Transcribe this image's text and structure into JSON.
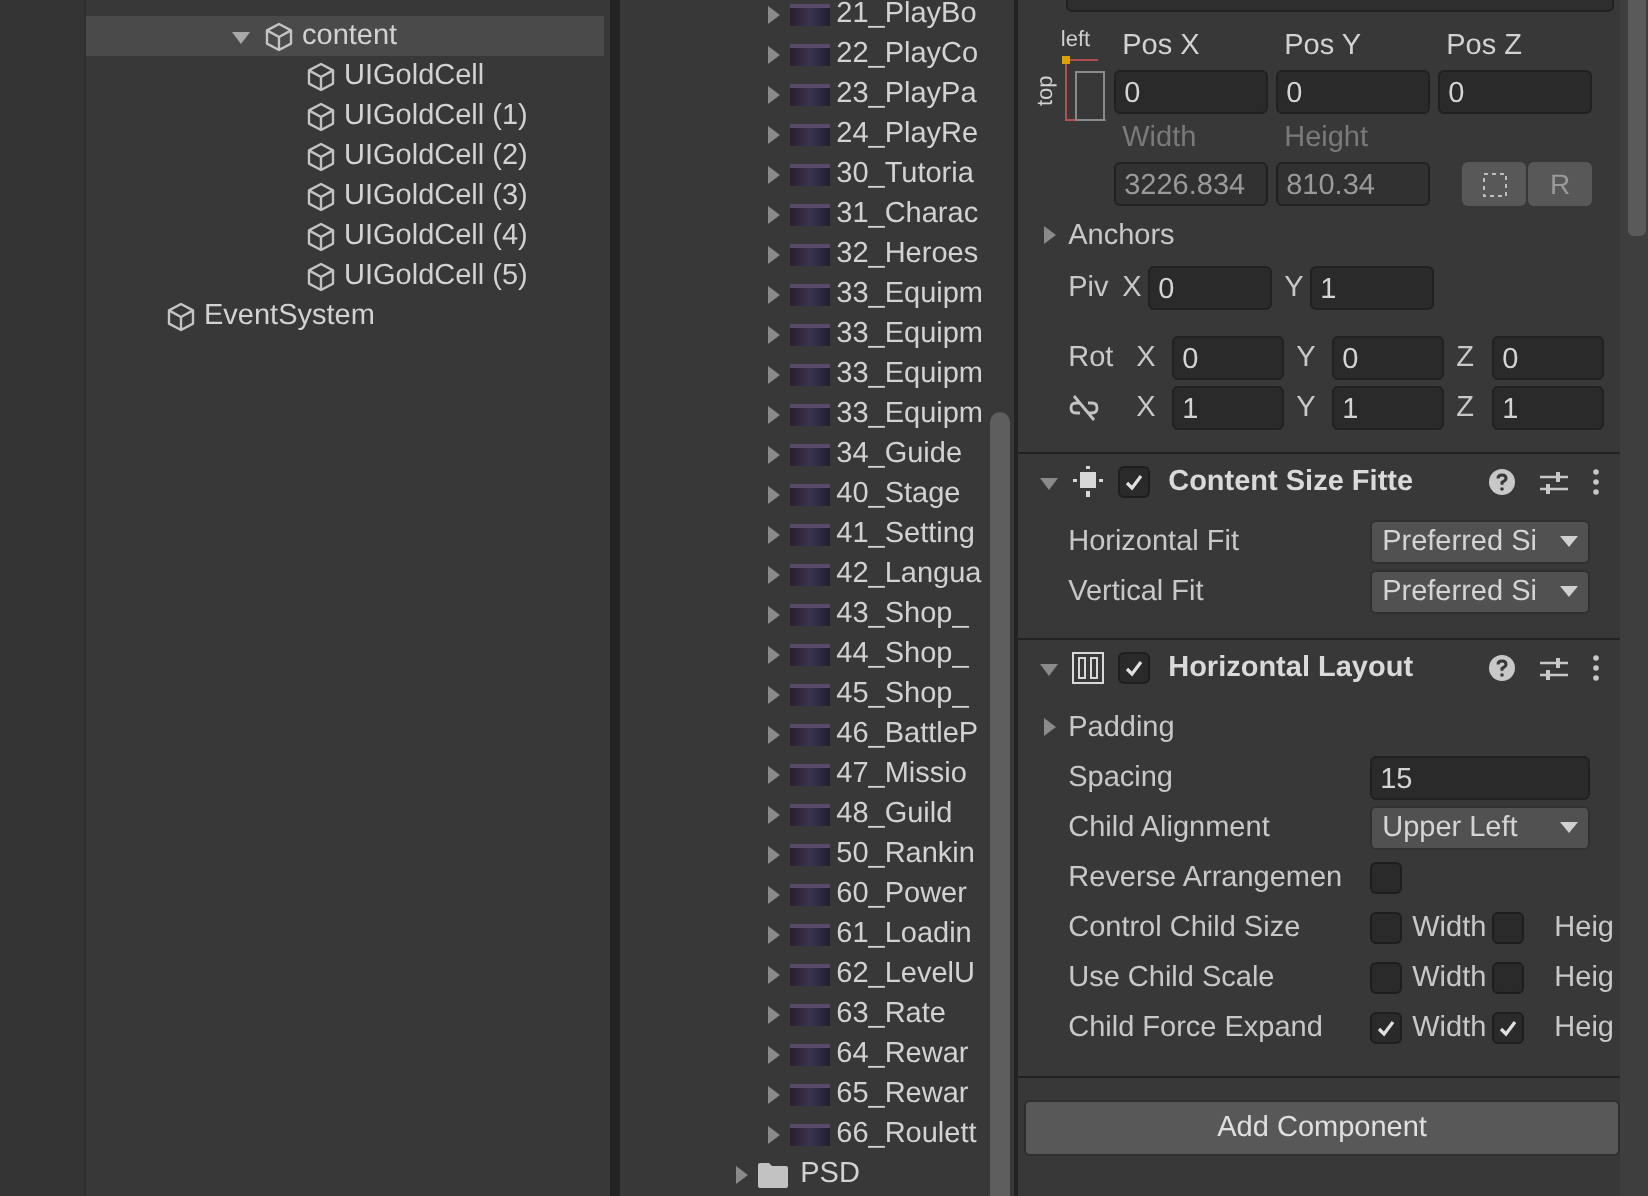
{
  "hierarchy": {
    "items": [
      {
        "name": "content",
        "selected": true,
        "expanded": true,
        "children": [
          {
            "name": "UIGoldCell",
            "selected": false
          },
          {
            "name": "UIGoldCell (1)",
            "selected": false
          },
          {
            "name": "UIGoldCell (2)",
            "selected": false
          },
          {
            "name": "UIGoldCell (3)",
            "selected": false
          },
          {
            "name": "UIGoldCell (4)",
            "selected": false
          },
          {
            "name": "UIGoldCell (5)",
            "selected": false
          }
        ]
      },
      {
        "name": "EventSystem",
        "selected": false
      }
    ]
  },
  "project": {
    "items": [
      {
        "name": "21_PlayBo",
        "kind": "prefab",
        "expanded": false
      },
      {
        "name": "22_PlayCo",
        "kind": "prefab",
        "expanded": false
      },
      {
        "name": "23_PlayPa",
        "kind": "prefab",
        "expanded": false
      },
      {
        "name": "24_PlayRe",
        "kind": "prefab",
        "expanded": false
      },
      {
        "name": "30_Tutoria",
        "kind": "prefab",
        "expanded": false
      },
      {
        "name": "31_Charac",
        "kind": "prefab",
        "expanded": false
      },
      {
        "name": "32_Heroes",
        "kind": "prefab",
        "expanded": false
      },
      {
        "name": "33_Equipm",
        "kind": "prefab",
        "expanded": false
      },
      {
        "name": "33_Equipm",
        "kind": "prefab",
        "expanded": false
      },
      {
        "name": "33_Equipm",
        "kind": "prefab",
        "expanded": false
      },
      {
        "name": "33_Equipm",
        "kind": "prefab",
        "expanded": false
      },
      {
        "name": "34_Guide",
        "kind": "prefab",
        "expanded": false
      },
      {
        "name": "40_Stage",
        "kind": "prefab",
        "expanded": false
      },
      {
        "name": "41_Setting",
        "kind": "prefab",
        "expanded": false
      },
      {
        "name": "42_Langua",
        "kind": "prefab",
        "expanded": false
      },
      {
        "name": "43_Shop_",
        "kind": "prefab",
        "expanded": false
      },
      {
        "name": "44_Shop_",
        "kind": "prefab",
        "expanded": false
      },
      {
        "name": "45_Shop_",
        "kind": "prefab",
        "expanded": false
      },
      {
        "name": "46_BattleP",
        "kind": "prefab",
        "expanded": false
      },
      {
        "name": "47_Missio",
        "kind": "prefab",
        "expanded": false
      },
      {
        "name": "48_Guild",
        "kind": "prefab",
        "expanded": false
      },
      {
        "name": "50_Rankin",
        "kind": "prefab",
        "expanded": false
      },
      {
        "name": "60_Power",
        "kind": "prefab",
        "expanded": false
      },
      {
        "name": "61_Loadin",
        "kind": "prefab",
        "expanded": false
      },
      {
        "name": "62_LevelU",
        "kind": "prefab",
        "expanded": false
      },
      {
        "name": "63_Rate",
        "kind": "prefab",
        "expanded": false
      },
      {
        "name": "64_Rewar",
        "kind": "prefab",
        "expanded": false
      },
      {
        "name": "65_Rewar",
        "kind": "prefab",
        "expanded": false
      },
      {
        "name": "66_Roulett",
        "kind": "prefab",
        "expanded": false
      },
      {
        "name": "PSD",
        "kind": "folder",
        "expanded": false
      }
    ]
  },
  "inspector": {
    "rect_transform": {
      "anchor_h": "left",
      "anchor_v": "top",
      "position": [
        {
          "label": "Pos X",
          "value": "0"
        },
        {
          "label": "Pos Y",
          "value": "0"
        },
        {
          "label": "Pos Z",
          "value": "0"
        }
      ],
      "size": [
        {
          "label": "Width",
          "value": "3226.834",
          "disabled": true
        },
        {
          "label": "Height",
          "value": "810.34",
          "disabled": true
        }
      ],
      "raw_button": "R",
      "anchors": {
        "label": "Anchors",
        "expanded": false
      },
      "pivot": {
        "label": "Piv",
        "fields": [
          {
            "axis": "X",
            "value": "0"
          },
          {
            "axis": "Y",
            "value": "1"
          }
        ]
      },
      "rotation": {
        "label": "Rot",
        "fields": [
          {
            "axis": "X",
            "value": "0"
          },
          {
            "axis": "Y",
            "value": "0"
          },
          {
            "axis": "Z",
            "value": "0"
          }
        ]
      },
      "scale": {
        "linked": false,
        "fields": [
          {
            "axis": "X",
            "value": "1"
          },
          {
            "axis": "Y",
            "value": "1"
          },
          {
            "axis": "Z",
            "value": "1"
          }
        ]
      }
    },
    "components": [
      {
        "title": "Content Size Fitte",
        "kind": "fitter",
        "enabled": true,
        "expanded": true,
        "props": [
          {
            "label": "Horizontal Fit",
            "kind": "dropdown",
            "value": "Preferred Si"
          },
          {
            "label": "Vertical Fit",
            "kind": "dropdown",
            "value": "Preferred Si"
          }
        ]
      },
      {
        "title": "Horizontal Layout",
        "kind": "layout",
        "enabled": true,
        "expanded": true,
        "props": [
          {
            "label": "Padding",
            "kind": "foldout",
            "expanded": false
          },
          {
            "label": "Spacing",
            "kind": "number",
            "value": "15"
          },
          {
            "label": "Child Alignment",
            "kind": "dropdown",
            "value": "Upper Left"
          },
          {
            "label": "Reverse Arrangemen",
            "kind": "checkbox",
            "checked": false
          },
          {
            "label": "Control Child Size",
            "kind": "pair",
            "options": [
              {
                "label": "Width",
                "checked": false
              },
              {
                "label": "Heig",
                "checked": false
              }
            ]
          },
          {
            "label": "Use Child Scale",
            "kind": "pair",
            "options": [
              {
                "label": "Width",
                "checked": false
              },
              {
                "label": "Heig",
                "checked": false
              }
            ]
          },
          {
            "label": "Child Force Expand",
            "kind": "pair",
            "options": [
              {
                "label": "Width",
                "checked": true
              },
              {
                "label": "Heig",
                "checked": true
              }
            ]
          }
        ]
      }
    ],
    "add_component": "Add Component"
  }
}
